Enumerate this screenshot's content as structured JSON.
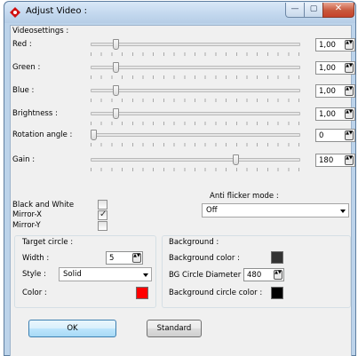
{
  "window": {
    "title": "Adjust Video :",
    "min_glyph": "—",
    "max_glyph": "▢",
    "close_glyph": "✕",
    "icon": "red-diamond-icon"
  },
  "videosettings": {
    "title": "Videosettings :",
    "rows": [
      {
        "label": "Red :",
        "value": "1,00",
        "level": 0.11
      },
      {
        "label": "Green :",
        "value": "1,00",
        "level": 0.11
      },
      {
        "label": "Blue :",
        "value": "1,00",
        "level": 0.11
      },
      {
        "label": "Brightness :",
        "value": "1,00",
        "level": 0.11
      },
      {
        "label": "Rotation angle :",
        "value": "0",
        "level": 0.0
      },
      {
        "label": "Gain :",
        "value": "180",
        "level": 0.7
      }
    ]
  },
  "options": {
    "black_and_white": {
      "label": "Black and White",
      "checked": false
    },
    "mirror_x": {
      "label": "Mirror-X",
      "checked": true
    },
    "mirror_y": {
      "label": "Mirror-Y",
      "checked": false
    }
  },
  "anti_flicker": {
    "label": "Anti flicker mode :",
    "value": "Off"
  },
  "target_circle": {
    "title": "Target circle :",
    "width_label": "Width :",
    "width_value": "5",
    "style_label": "Style :",
    "style_value": "Solid",
    "color_label": "Color :",
    "color": "#ff0000"
  },
  "background": {
    "title": "Background :",
    "bg_color_label": "Background color :",
    "bg_color": "#333333",
    "diameter_label": "BG Circle Diameter :",
    "diameter_value": "480",
    "circle_color_label": "Background circle color :",
    "circle_color": "#000000"
  },
  "buttons": {
    "ok": "OK",
    "standard": "Standard"
  },
  "check_glyph": "✓",
  "spin_glyph": "▲▼"
}
